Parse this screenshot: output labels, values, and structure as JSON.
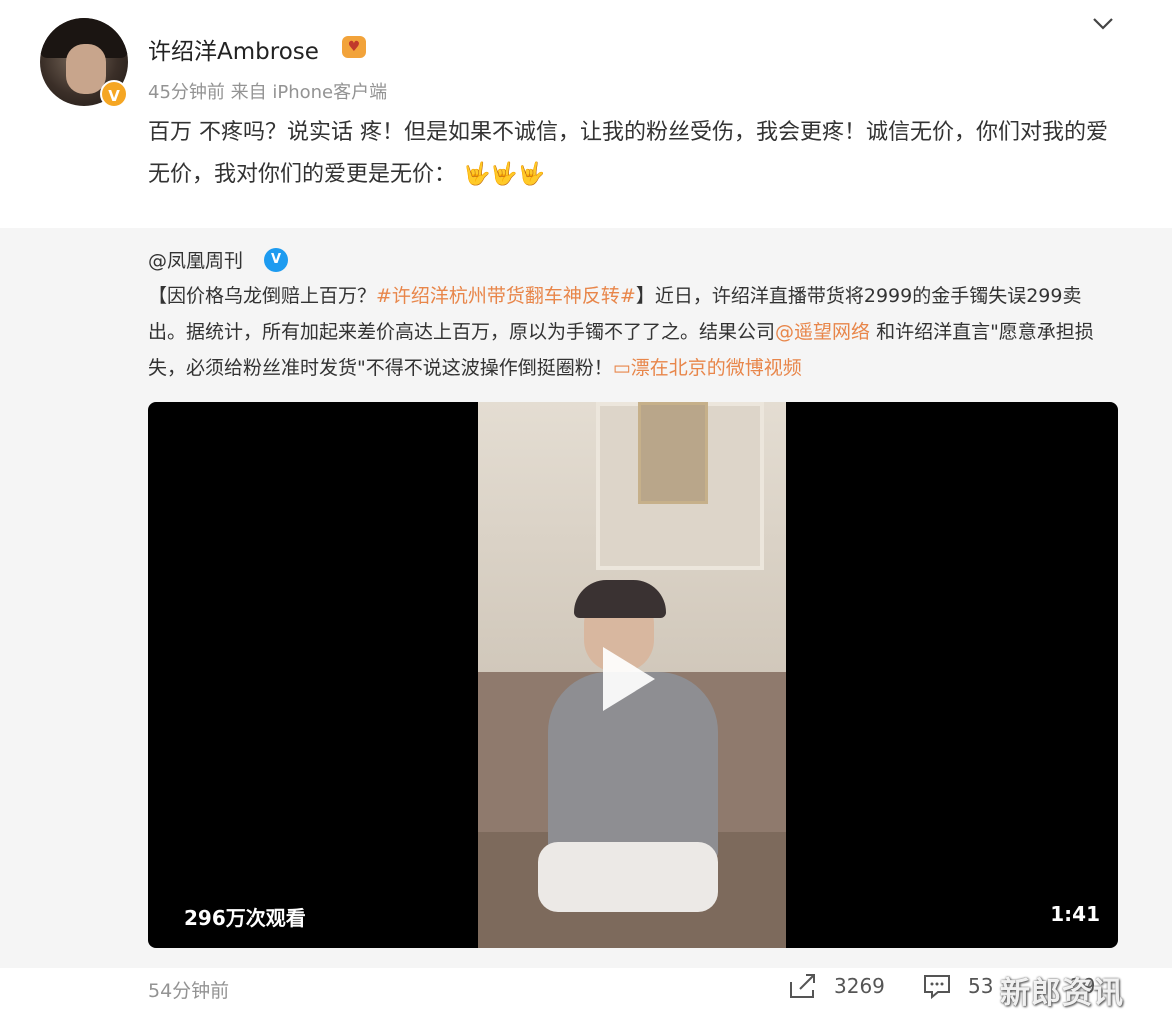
{
  "post": {
    "username": "许绍洋Ambrose",
    "meta": "45分钟前  来自 iPhone客户端",
    "content": "百万 不疼吗？说实话 疼！但是如果不诚信，让我的粉丝受伤，我会更疼！诚信无价，你们对我的爱无价，我对你们的爱更是无价：",
    "emoji": "🤟🤟🤟"
  },
  "repost": {
    "source_user": "@凤凰周刊",
    "verified_badge": "V",
    "text_part1": "【因价格乌龙倒赔上百万？",
    "hashtag": "#许绍洋杭州带货翻车神反转#",
    "text_part2": "】近日，许绍洋直播带货将2999的金手镯失误299卖出。据统计，所有加起来差价高达上百万，原以为手镯不了了之。结果公司",
    "mention": "@遥望网络",
    "text_part3": " 和许绍洋直言\"愿意承担损失，必须给粉丝准时发货\"不得不说这波操作倒挺圈粉！",
    "video_link": "漂在北京的微博视频"
  },
  "video": {
    "views": "296万次观看",
    "duration": "1:41"
  },
  "footer": {
    "time": "54分钟前",
    "reposts": "3269",
    "comments": "53",
    "likes": "2",
    "likes_tail": "9",
    "watermark": "新郎资讯"
  },
  "icons": {
    "chevron": "chevron-down-icon",
    "share": "share-icon",
    "comment": "comment-icon",
    "vip": "vip-badge-icon"
  }
}
